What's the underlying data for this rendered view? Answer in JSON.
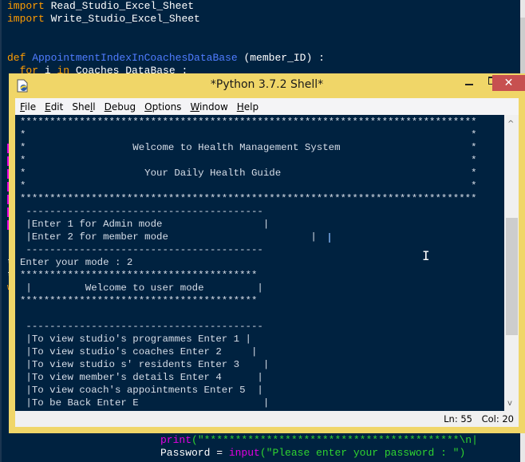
{
  "editor": {
    "lines": [
      {
        "kw": "import",
        "rest": " Read_Studio_Excel_Sheet"
      },
      {
        "kw": "import",
        "rest": " Write_Studio_Excel_Sheet"
      },
      {
        "kw": "def",
        "fn": " AppointmentIndexInCoachesDataBase",
        "rest": " (member_ID) :"
      },
      {
        "kw": "  for",
        "rest": " i ",
        "kw2": "in",
        "rest2": " Coaches_DataBase :"
      }
    ],
    "bottom_lines": [
      {
        "bi": "print",
        "st": "(\"*****************************************\\n|"
      },
      {
        "plain": "Password = ",
        "bi": "input",
        "st": "(\"Please enter your password : \")"
      }
    ],
    "gutter_chars": [
      "t",
      "t",
      "w"
    ]
  },
  "shell": {
    "title": "*Python 3.7.2 Shell*",
    "window_controls": {
      "minimize": "minimize",
      "maximize": "maximize",
      "close": "✕"
    },
    "menu": [
      {
        "label": "File",
        "accel": "F"
      },
      {
        "label": "Edit",
        "accel": "E"
      },
      {
        "label": "Shell",
        "accel": "l"
      },
      {
        "label": "Debug",
        "accel": "D"
      },
      {
        "label": "Options",
        "accel": "O"
      },
      {
        "label": "Window",
        "accel": "W"
      },
      {
        "label": "Help",
        "accel": "H"
      }
    ],
    "console_lines": [
      "*****************************************************************************",
      "*                                                                           *",
      "*                  Welcome to Health Management System                      *",
      "*                                                                           *",
      "*                    Your Daily Health Guide                                *",
      "*                                                                           *",
      "*****************************************************************************",
      " ----------------------------------------",
      " |Enter 1 for Admin mode                 |",
      " |Enter 2 for member mode                        |",
      " ----------------------------------------",
      "Enter your mode : 2",
      "****************************************",
      " |         Welcome to user mode         |",
      "****************************************",
      "",
      " ----------------------------------------",
      " |To view studio's programmes Enter 1 |",
      " |To view studio's coaches Enter 2     |",
      " |To view studio s' residents Enter 3    |",
      " |To view member's details Enter 4      |",
      " |To view coach's appointments Enter 5  |",
      " |To be Back Enter E                     |"
    ],
    "status": {
      "ln": "Ln: 55",
      "col": "Col: 20"
    }
  }
}
